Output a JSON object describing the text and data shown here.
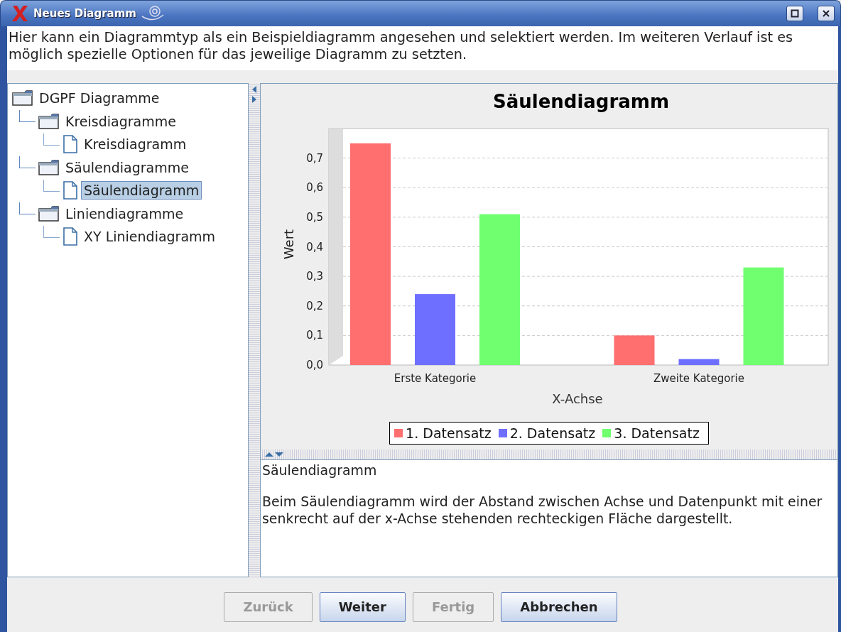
{
  "window": {
    "title": "Neues Diagramm"
  },
  "description": "Hier kann ein Diagrammtyp als ein Beispieldiagramm angesehen und selektiert werden. Im weiteren Verlauf ist es möglich spezielle Optionen für das jeweilige Diagramm zu setzten.",
  "tree": {
    "label": "DGPF Diagramme",
    "kind": "folder",
    "selected": false,
    "children": [
      {
        "label": "Kreisdiagramme",
        "kind": "folder",
        "selected": false,
        "children": [
          {
            "label": "Kreisdiagramm",
            "kind": "file",
            "selected": false
          }
        ]
      },
      {
        "label": "Säulendiagramme",
        "kind": "folder",
        "selected": false,
        "children": [
          {
            "label": "Säulendiagramm",
            "kind": "file",
            "selected": true
          }
        ]
      },
      {
        "label": "Liniendiagramme",
        "kind": "folder",
        "selected": false,
        "children": [
          {
            "label": "XY Liniendiagramm",
            "kind": "file",
            "selected": false
          }
        ]
      }
    ]
  },
  "preview": {
    "chart_data": {
      "type": "bar",
      "title": "Säulendiagramm",
      "xlabel": "X-Achse",
      "ylabel": "Wert",
      "categories": [
        "Erste Kategorie",
        "Zweite Kategorie"
      ],
      "series": [
        {
          "name": "1. Datensatz",
          "color": "#ff6f6f",
          "values": [
            0.75,
            0.1
          ]
        },
        {
          "name": "2. Datensatz",
          "color": "#6f6fff",
          "values": [
            0.24,
            0.02
          ]
        },
        {
          "name": "3. Datensatz",
          "color": "#6fff6f",
          "values": [
            0.51,
            0.33
          ]
        }
      ],
      "grid": true,
      "legend": "bottom",
      "ylim": [
        0,
        0.8
      ],
      "yticks": [
        {
          "value": 0,
          "label": "0,0"
        },
        {
          "value": 0.1,
          "label": "0,1"
        },
        {
          "value": 0.2,
          "label": "0,2"
        },
        {
          "value": 0.3,
          "label": "0,3"
        },
        {
          "value": 0.4,
          "label": "0,4"
        },
        {
          "value": 0.5,
          "label": "0,5"
        },
        {
          "value": 0.6,
          "label": "0,6"
        },
        {
          "value": 0.7,
          "label": "0,7"
        }
      ]
    }
  },
  "info": {
    "title": "Säulendiagramm",
    "text": "Beim Säulendiagramm wird der Abstand zwischen Achse und Datenpunkt mit einer senkrecht auf der x-Achse stehenden rechteckigen Fläche dargestellt."
  },
  "buttons": [
    {
      "label": "Zurück",
      "disabled": true
    },
    {
      "label": "Weiter",
      "disabled": false
    },
    {
      "label": "Fertig",
      "disabled": true
    },
    {
      "label": "Abbrechen",
      "disabled": false
    }
  ]
}
